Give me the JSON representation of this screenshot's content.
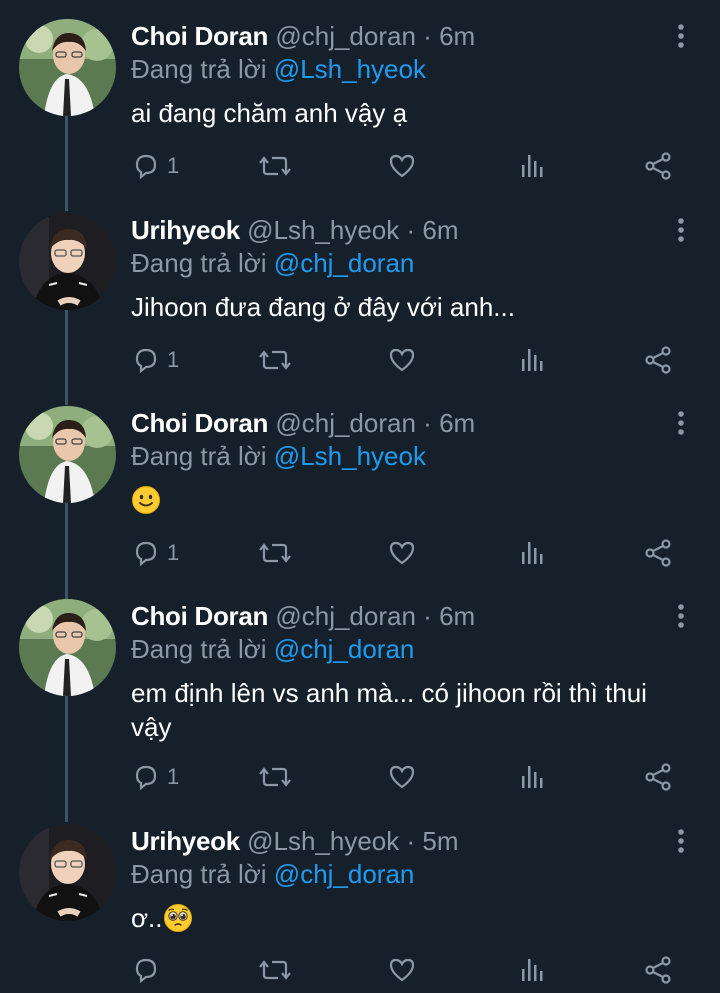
{
  "colors": {
    "background": "#15202b",
    "secondary_text": "#8b98a5",
    "mention": "#1d9bf0",
    "thread_line": "#3d5466"
  },
  "reply_label": "Đang trả lời",
  "tweets": [
    {
      "name": "Choi Doran",
      "handle": "@chj_doran",
      "dot": "·",
      "time": "6m",
      "reply_to": "@Lsh_hyeok",
      "text": "ai đang chăm anh vậy ạ",
      "reply_count": "1",
      "avatar": "avatar-choi-doran"
    },
    {
      "name": "Urihyeok",
      "handle": "@Lsh_hyeok",
      "dot": "·",
      "time": "6m",
      "reply_to": "@chj_doran",
      "text": "Jihoon đưa đang ở đây với anh...",
      "reply_count": "1",
      "avatar": "avatar-urihyeok"
    },
    {
      "name": "Choi Doran",
      "handle": "@chj_doran",
      "dot": "·",
      "time": "6m",
      "reply_to": "@Lsh_hyeok",
      "text": "",
      "emoji": "slightly-smiling-face-emoji",
      "reply_count": "1",
      "avatar": "avatar-choi-doran"
    },
    {
      "name": "Choi Doran",
      "handle": "@chj_doran",
      "dot": "·",
      "time": "6m",
      "reply_to": "@chj_doran",
      "text": "em định lên vs anh mà... có jihoon rồi thì thui vậy",
      "reply_count": "1",
      "avatar": "avatar-choi-doran"
    },
    {
      "name": "Urihyeok",
      "handle": "@Lsh_hyeok",
      "dot": "·",
      "time": "5m",
      "reply_to": "@chj_doran",
      "text": "ơ..",
      "emoji": "pleading-face-emoji",
      "reply_count": "",
      "avatar": "avatar-urihyeok"
    }
  ],
  "icons": [
    "reply-icon",
    "retweet-icon",
    "like-icon",
    "analytics-icon",
    "share-icon",
    "more-options-icon"
  ]
}
